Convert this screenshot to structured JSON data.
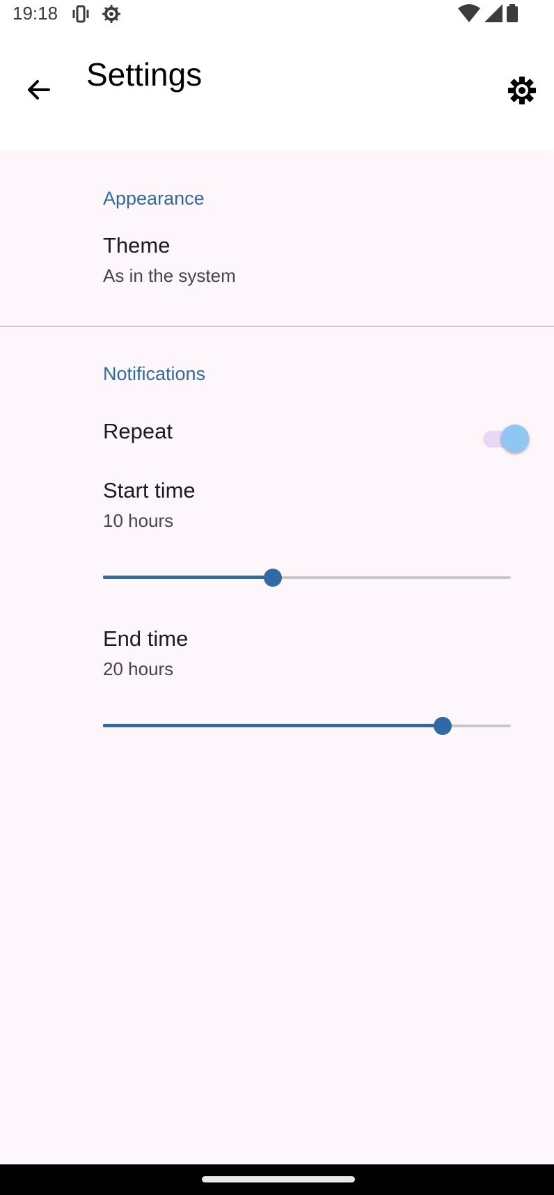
{
  "status_bar": {
    "time": "19:18",
    "icons_left": [
      "vibrate-icon",
      "settings-gear-icon"
    ],
    "icons_right": [
      "wifi-icon",
      "signal-icon",
      "battery-icon"
    ]
  },
  "app_bar": {
    "title": "Settings",
    "back_icon": "arrow-back-icon",
    "action_icon": "gear-icon"
  },
  "sections": [
    {
      "header": "Appearance",
      "items": [
        {
          "title": "Theme",
          "summary": "As in the system"
        }
      ]
    },
    {
      "header": "Notifications",
      "items": [
        {
          "title": "Repeat",
          "type": "switch",
          "checked": true
        },
        {
          "title": "Start time",
          "summary": "10 hours",
          "type": "slider",
          "fraction": 0.416
        },
        {
          "title": "End time",
          "summary": "20 hours",
          "type": "slider",
          "fraction": 0.833
        }
      ]
    }
  ],
  "colors": {
    "accent": "#2e6aa3",
    "background": "#fdf7fb",
    "switch_thumb": "#8ec8f2",
    "switch_track": "#e9d7f6"
  }
}
